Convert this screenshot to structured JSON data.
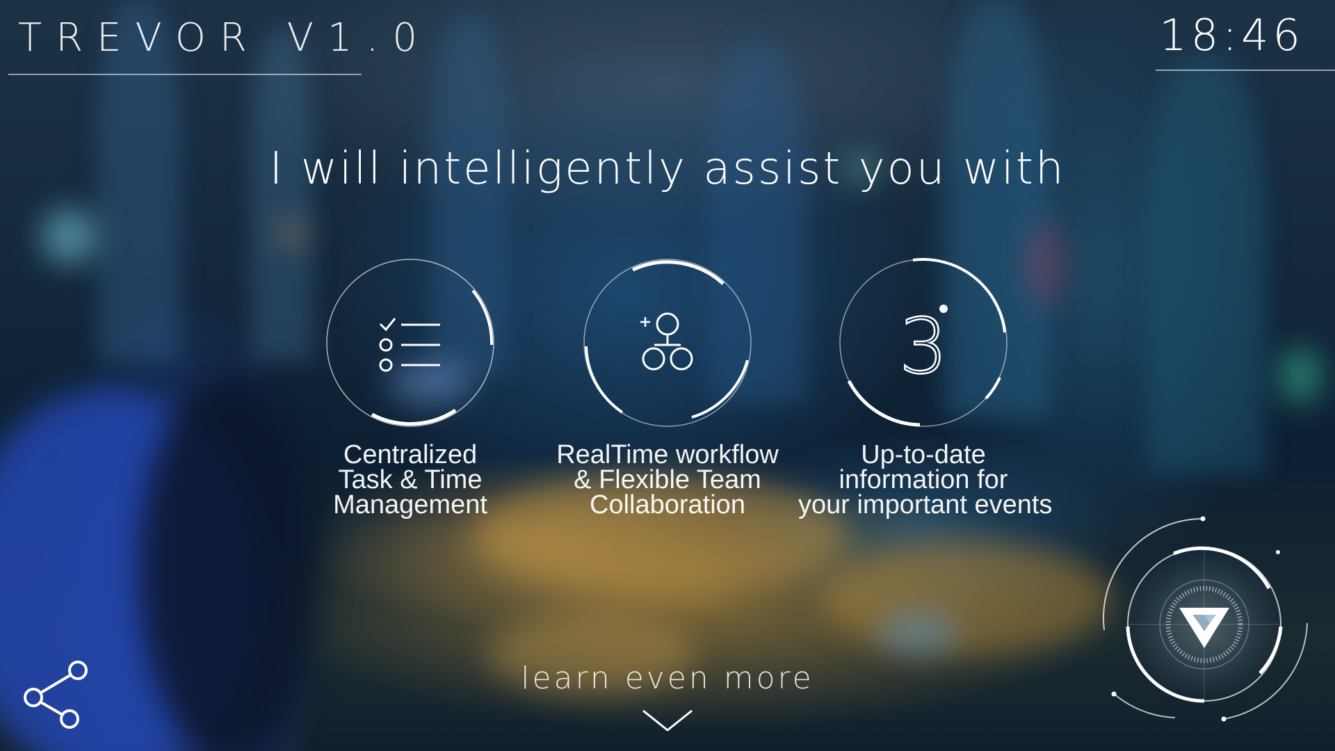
{
  "header": {
    "app_title": "TREVOR V1.0",
    "clock": "18:46"
  },
  "headline": "I will intelligently assist you with",
  "features": [
    {
      "icon": "checklist-icon",
      "lines": [
        "Centralized",
        "Task & Time",
        "Management"
      ]
    },
    {
      "icon": "team-collaboration-icon",
      "lines": [
        "RealTime workflow",
        "& Flexible Team",
        "Collaboration"
      ]
    },
    {
      "icon": "events-calendar-icon",
      "icon_text": "3",
      "lines": [
        "Up-to-date",
        "information for",
        "your important events"
      ]
    }
  ],
  "footer": {
    "learn_more": "learn even more",
    "share_icon": "share-icon",
    "assistant_icon": "trevor-logo-icon"
  },
  "colors": {
    "text": "#ffffff",
    "wave": "#8fd6ff",
    "accent": "#3a8fd0"
  }
}
